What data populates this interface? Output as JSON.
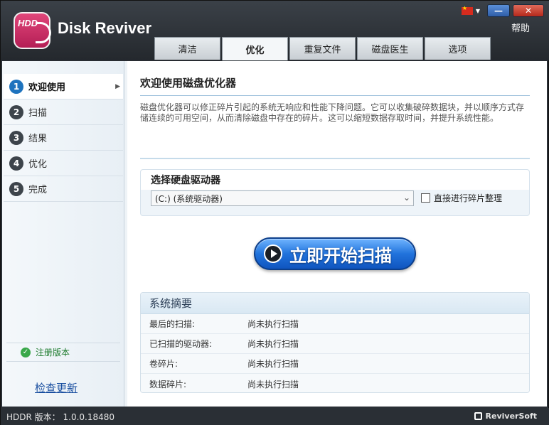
{
  "app": {
    "logo_text": "HDD",
    "title": "Disk Reviver",
    "help_label": "帮助"
  },
  "tabs": [
    {
      "label": "清洁",
      "active": false
    },
    {
      "label": "优化",
      "active": true
    },
    {
      "label": "重复文件",
      "active": false
    },
    {
      "label": "磁盘医生",
      "active": false
    },
    {
      "label": "选项",
      "active": false
    }
  ],
  "sidebar": {
    "steps": [
      {
        "num": "1",
        "label": "欢迎使用",
        "active": true
      },
      {
        "num": "2",
        "label": "扫描",
        "active": false
      },
      {
        "num": "3",
        "label": "结果",
        "active": false
      },
      {
        "num": "4",
        "label": "优化",
        "active": false
      },
      {
        "num": "5",
        "label": "完成",
        "active": false
      }
    ],
    "registered_label": "注册版本",
    "check_update_label": "检查更新"
  },
  "main": {
    "title": "欢迎使用磁盘优化器",
    "description": "磁盘优化器可以修正碎片引起的系统无响应和性能下降问题。它可以收集破碎数据块，并以顺序方式存储连续的可用空间，从而清除磁盘中存在的碎片。这可以缩短数据存取时间，并提升系统性能。",
    "drive_section_label": "选择硬盘驱动器",
    "drive_selected": "(C:)  (系统驱动器)",
    "defrag_checkbox_label": "直接进行碎片整理",
    "scan_button_label": "立即开始扫描"
  },
  "summary": {
    "title": "系统摘要",
    "rows": [
      {
        "key": "最后的扫描:",
        "value": "尚未执行扫描"
      },
      {
        "key": "已扫描的驱动器:",
        "value": "尚未执行扫描"
      },
      {
        "key": "卷碎片:",
        "value": "尚未执行扫描"
      },
      {
        "key": "数据碎片:",
        "value": "尚未执行扫描"
      }
    ]
  },
  "status": {
    "version_label": "HDDR 版本：",
    "version_value": "1.0.0.18480",
    "brand": "ReviverSoft"
  },
  "colors": {
    "accent": "#1e73be",
    "scan_button": "#2173dc",
    "logo": "#c8286a",
    "registered": "#1b7a2b"
  }
}
